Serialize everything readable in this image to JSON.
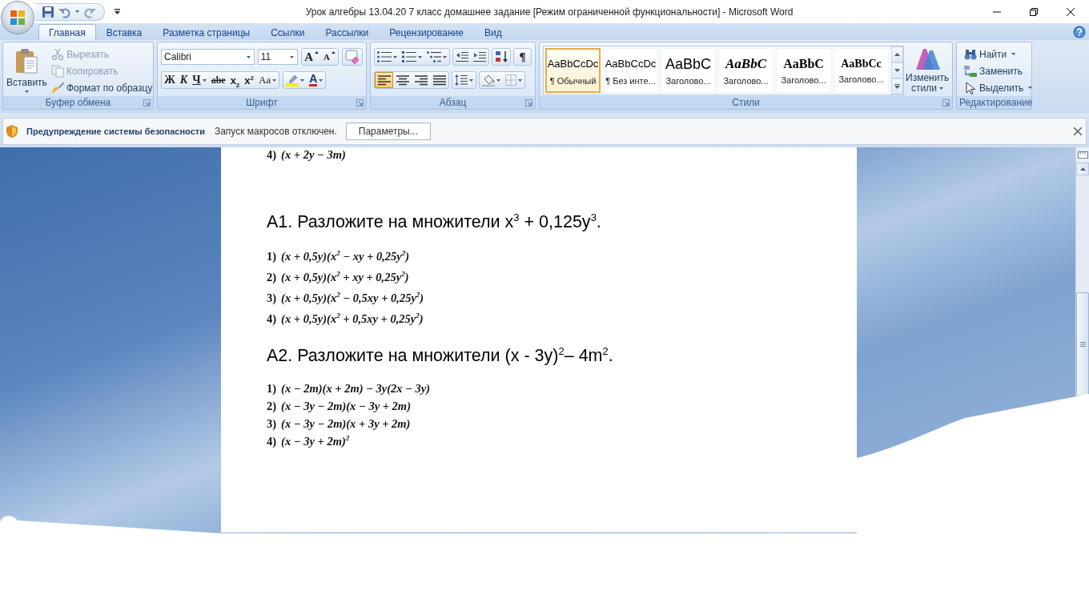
{
  "window": {
    "title": "Урок алгебры 13.04.20 7 класс домашнее задание [Режим ограниченной функциональности] - Microsoft Word"
  },
  "tabs": [
    {
      "label": "Главная",
      "selected": true
    },
    {
      "label": "Вставка",
      "selected": false
    },
    {
      "label": "Разметка страницы",
      "selected": false
    },
    {
      "label": "Ссылки",
      "selected": false
    },
    {
      "label": "Рассылки",
      "selected": false
    },
    {
      "label": "Рецензирование",
      "selected": false
    },
    {
      "label": "Вид",
      "selected": false
    }
  ],
  "ribbon": {
    "clipboard": {
      "label": "Буфер обмена",
      "launcher": true,
      "paste": "Вставить",
      "items": [
        {
          "kind": "cut",
          "label": "Вырезать",
          "disabled": true
        },
        {
          "kind": "copy",
          "label": "Копировать",
          "disabled": true
        },
        {
          "kind": "format_painter",
          "label": "Формат по образцу",
          "disabled": false
        }
      ]
    },
    "font": {
      "label": "Шрифт",
      "launcher": true,
      "font_name": "Calibri",
      "font_size": "11",
      "size_buttons": [
        {
          "kind": "grow",
          "label": "A"
        },
        {
          "kind": "shrink",
          "label": "A"
        }
      ],
      "format_buttons": [
        {
          "kind": "bold",
          "label": "Ж",
          "dropdown": false
        },
        {
          "kind": "italic",
          "label": "К",
          "dropdown": false
        },
        {
          "kind": "underline",
          "label": "Ч",
          "dropdown": true
        },
        {
          "kind": "strike",
          "label": "abe",
          "dropdown": false
        },
        {
          "kind": "subscript",
          "label": "x$_{2}$",
          "dropdown": false
        },
        {
          "kind": "superscript",
          "label": "x$^{2}$",
          "dropdown": false
        },
        {
          "kind": "case",
          "label": "Aa",
          "dropdown": true
        }
      ],
      "font_color": "A"
    },
    "paragraph": {
      "label": "Абзац",
      "launcher": true,
      "show_marks": "¶",
      "alignment": [
        {
          "kind": "left",
          "selected": true
        },
        {
          "kind": "center",
          "selected": false
        },
        {
          "kind": "right",
          "selected": false
        },
        {
          "kind": "justify",
          "selected": false
        }
      ]
    },
    "styles": {
      "label": "Стили",
      "launcher": true,
      "items": [
        {
          "kind": "body",
          "preview": "AaBbCcDc",
          "name": "¶ Обычный",
          "selected": true
        },
        {
          "kind": "body",
          "preview": "AaBbCcDc",
          "name": "¶ Без инте...",
          "selected": false
        },
        {
          "kind": "heading",
          "preview": "AaBbC",
          "name": "Заголово...",
          "selected": false
        },
        {
          "kind": "heading_italic",
          "preview": "AaBbC",
          "name": "Заголово...",
          "selected": false
        },
        {
          "kind": "heading_serif",
          "preview": "AaBbC",
          "name": "Заголово...",
          "selected": false
        },
        {
          "kind": "heading_serif_small",
          "preview": "AaBbCc",
          "name": "Заголово...",
          "selected": false
        }
      ],
      "change_styles": "Изменить стили"
    },
    "editing": {
      "label": "Редактирование",
      "launcher": false,
      "items": [
        {
          "kind": "find",
          "label": "Найти",
          "dropdown": true
        },
        {
          "kind": "replace",
          "label": "Заменить",
          "dropdown": false
        },
        {
          "kind": "select",
          "label": "Выделить",
          "dropdown": true
        }
      ]
    }
  },
  "security_bar": {
    "title": "Предупреждение системы безопасности",
    "message": "Запуск макросов отключен.",
    "button": "Параметры..."
  },
  "document": {
    "blocks": [
      {
        "kind": "options",
        "items": [
          {
            "number": "4)",
            "expression": "(x + 2y − 3m)"
          }
        ]
      },
      {
        "kind": "heading",
        "text": "A1. Разложите на множители x$^{3}$ + 0,125y$^{3}$."
      },
      {
        "kind": "options",
        "items": [
          {
            "number": "1)",
            "expression": "(x + 0,5y)(x$^{2}$ − xy + 0,25y$^{2}$)"
          },
          {
            "number": "2)",
            "expression": "(x + 0,5y)(x$^{2}$ + xy + 0,25y$^{2}$)"
          },
          {
            "number": "3)",
            "expression": "(x + 0,5y)(x$^{2}$ − 0,5xy + 0,25y$^{2}$)"
          },
          {
            "number": "4)",
            "expression": "(x + 0,5y)(x$^{2}$ + 0,5xy + 0,25y$^{2}$)"
          }
        ]
      },
      {
        "kind": "heading",
        "text": "A2. Разложите на множители (x - 3y)$^{2}$– 4m$^{2}$."
      },
      {
        "kind": "options",
        "items": [
          {
            "number": "1)",
            "expression": "(x − 2m)(x + 2m) − 3y(2x − 3y)"
          },
          {
            "number": "2)",
            "expression": "(x − 3y − 2m)(x − 3y + 2m)"
          },
          {
            "number": "3)",
            "expression": "(x − 3y − 2m)(x + 3y + 2m)"
          },
          {
            "number": "4)",
            "expression": "(x − 3y + 2m)$^{2}$"
          }
        ]
      }
    ]
  }
}
